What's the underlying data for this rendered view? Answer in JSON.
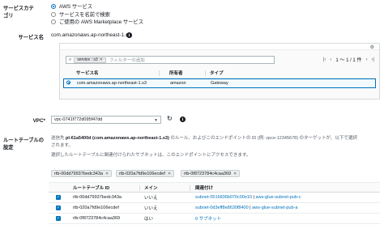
{
  "service_category": {
    "label": "サービスカテゴリ",
    "options": [
      {
        "label": "AWS サービス",
        "selected": true
      },
      {
        "label": "サービスを名前で検索",
        "selected": false
      },
      {
        "label": "ご使用の AWS Marketplace サービス",
        "selected": false
      }
    ]
  },
  "service_name": {
    "label": "サービス名",
    "value": "com.amazonaws.ap-northeast-1.s3",
    "info_icon": "info-icon"
  },
  "services_table": {
    "filter_token": "service : s3",
    "filter_placeholder": "フィルターの追加",
    "pagination": "1 〜 1 / 1 件",
    "pagination_start_symbol": "|‹",
    "pagination_prev_symbol": "‹",
    "pagination_next_symbol": "›",
    "pagination_end_symbol": "›|",
    "columns": [
      "サービス名",
      "所有者",
      "タイプ"
    ],
    "rows": [
      {
        "service": "com.amazonaws.ap-northeast-1.s3",
        "owner": "amazon",
        "type": "Gateway",
        "selected": true
      }
    ]
  },
  "vpc": {
    "label": "VPC*",
    "value": "vpc-0741f772d095f47dd"
  },
  "route_tables": {
    "label": "ルートテーブルの設定",
    "desc_line1_prefix": "送信先 ",
    "desc_line1_bold": "pl-61a5400d (com.amazonaws.ap-northeast-1.s3)",
    "desc_line1_suffix": " のルール、およびこのエンドポイントの ID (例: vpce-12345678) のターゲットが、以下で選択",
    "desc_line2": "されます。",
    "desc_line3": "選択したルートテーブルに関連付けられたサブネットは、このエンドポイントにアクセスできます。",
    "chips": [
      "rtb-00dd79937bedc343a",
      "rtb-020a7fd9e106ecdef",
      "rtb-0f8723784c4caa369"
    ],
    "columns": [
      "ルートテーブル ID",
      "メイン",
      "関連付け"
    ],
    "rows": [
      {
        "id": "rtb-00dd79937bedc343a",
        "main": "いいえ",
        "assoc_link1": "subnet-0516836b070c00e10",
        "assoc_link2": "aws-glue-subnet-pub-c"
      },
      {
        "id": "rtb-020a7fd9e106ecdef",
        "main": "いいえ",
        "assoc_link1": "subnet-0d3eff8e8630f8400",
        "assoc_link2": "aws-glue-subnet-pub-a"
      },
      {
        "id": "rtb-0f8723784c4caa369",
        "main": "はい",
        "assoc_link1": "0 サブネット",
        "assoc_link2": ""
      }
    ]
  },
  "colors": {
    "accent": "#0073bb",
    "row_highlight": "#f1faff"
  }
}
